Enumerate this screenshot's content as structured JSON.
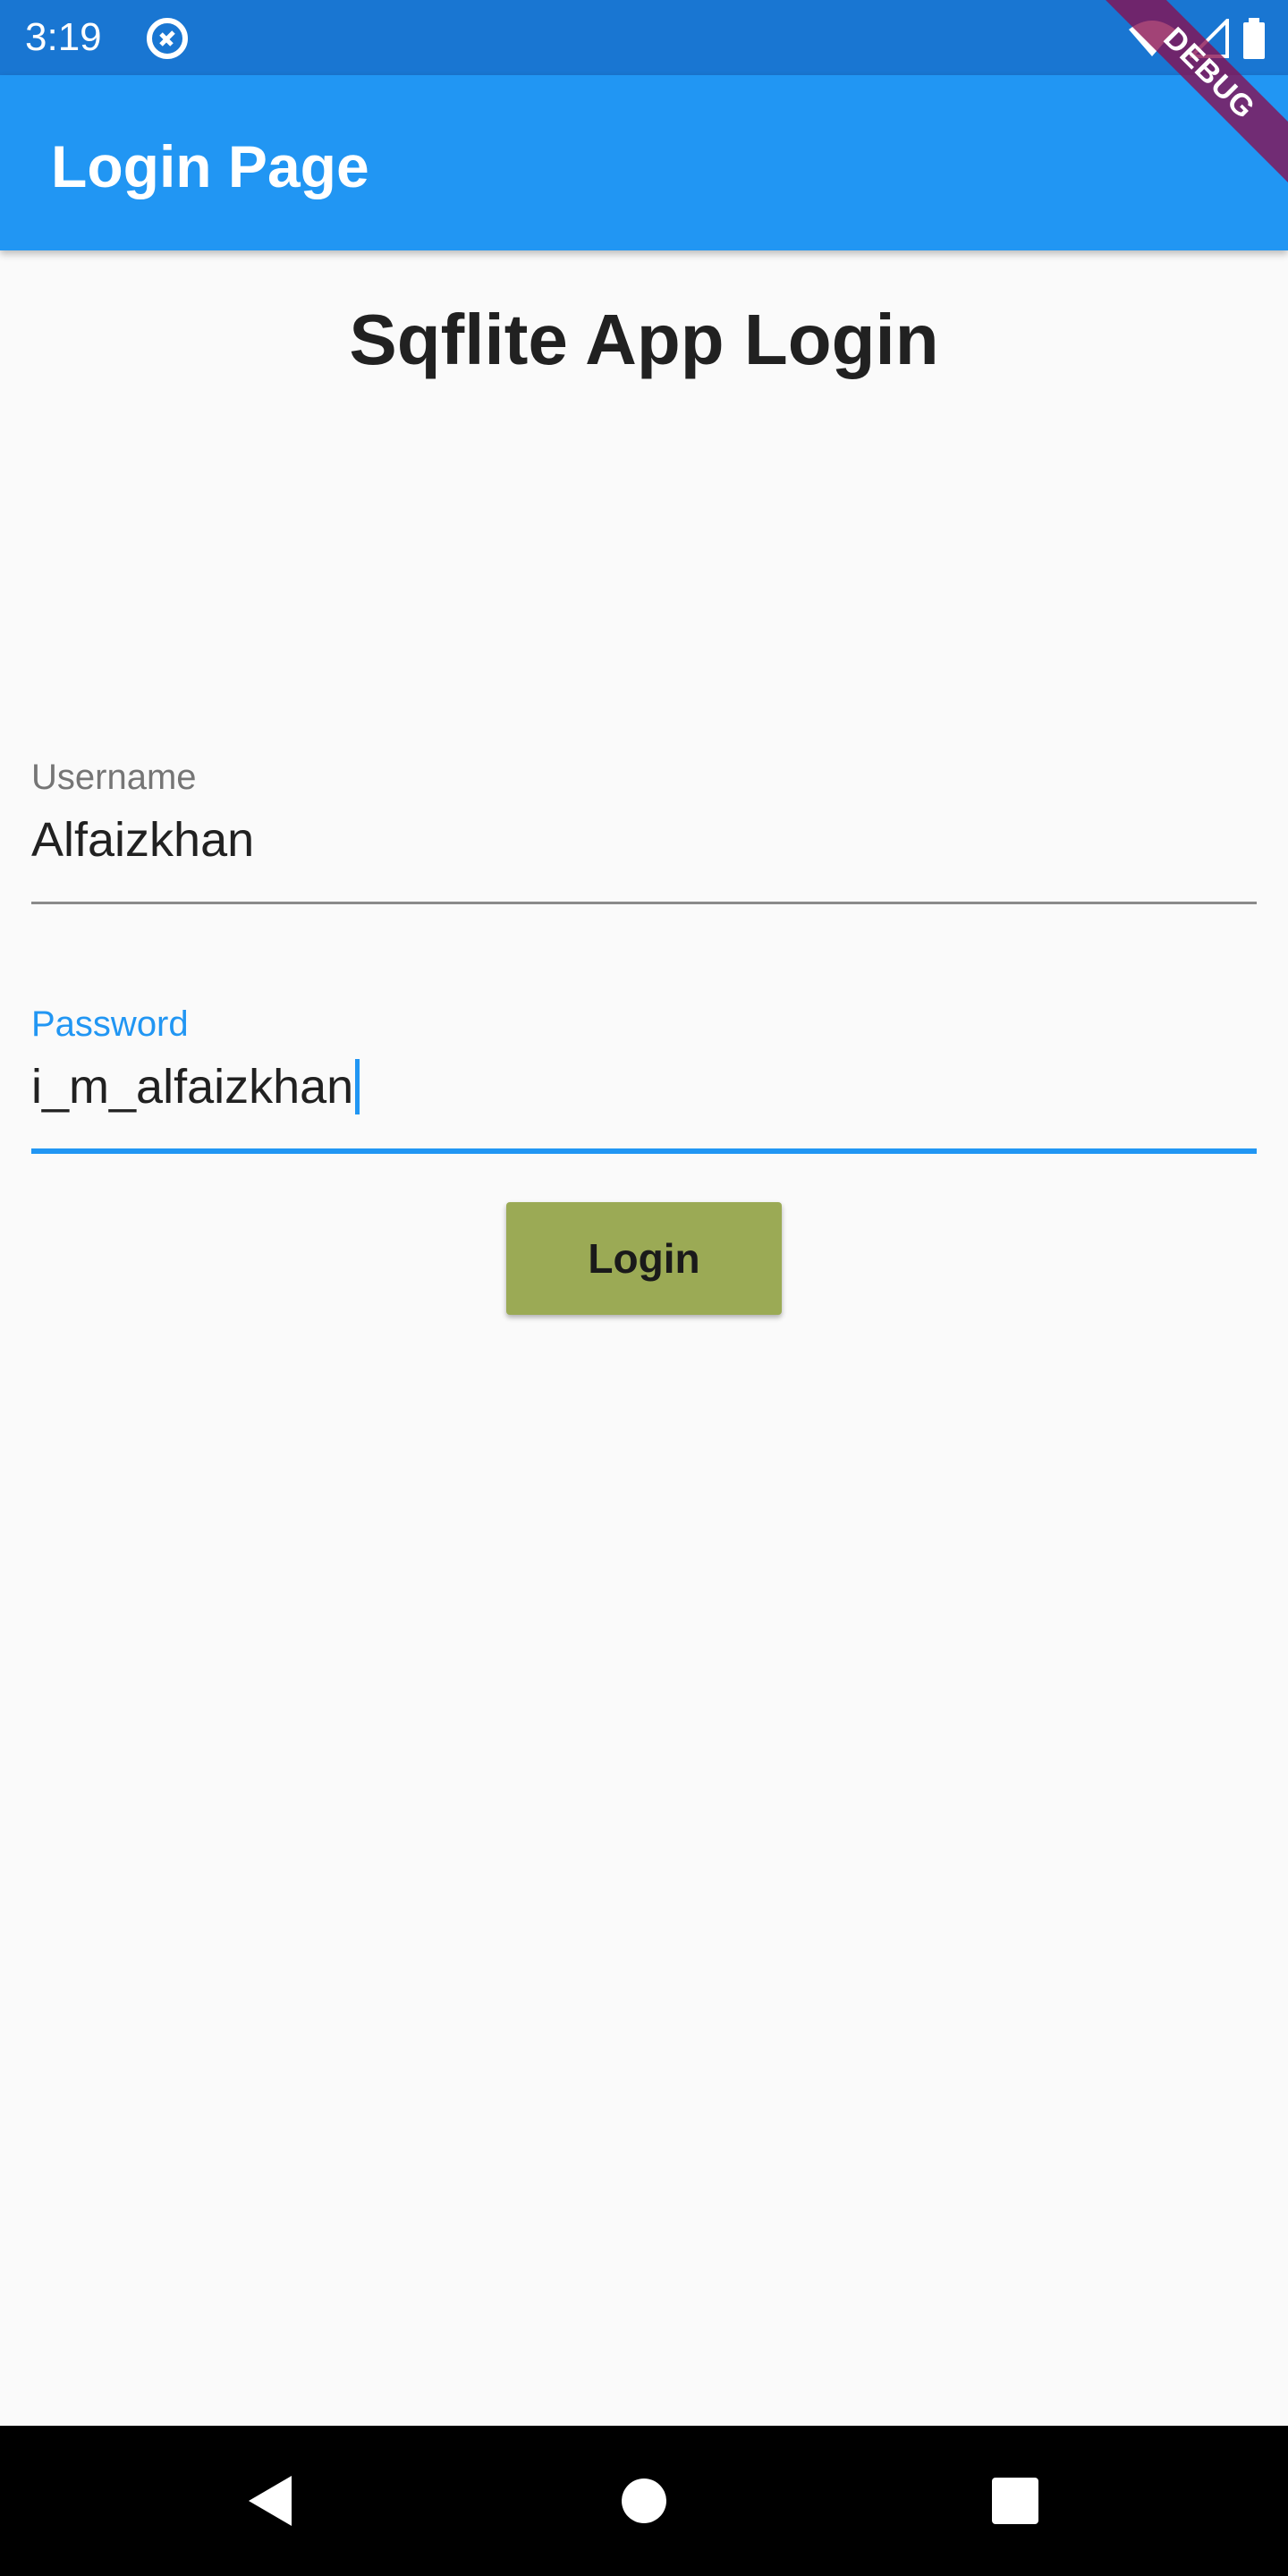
{
  "status_bar": {
    "time": "3:19",
    "icons": [
      "app-notification-icon",
      "wifi-icon",
      "signal-icon",
      "battery-icon"
    ]
  },
  "app_bar": {
    "title": "Login Page"
  },
  "debug_banner": {
    "text": "DEBUG"
  },
  "main": {
    "heading": "Sqflite App Login",
    "username": {
      "label": "Username",
      "value": "Alfaizkhan"
    },
    "password": {
      "label": "Password",
      "value": "i_m_alfaizkhan"
    },
    "login_button": "Login"
  },
  "nav_bar": {
    "icons": [
      "back-icon",
      "home-icon",
      "recents-icon"
    ]
  },
  "colors": {
    "status_bar": "#1976D2",
    "app_bar": "#2196F3",
    "focused_accent": "#2196F3",
    "button": "#9BAA55",
    "background": "#FAFAFA"
  }
}
